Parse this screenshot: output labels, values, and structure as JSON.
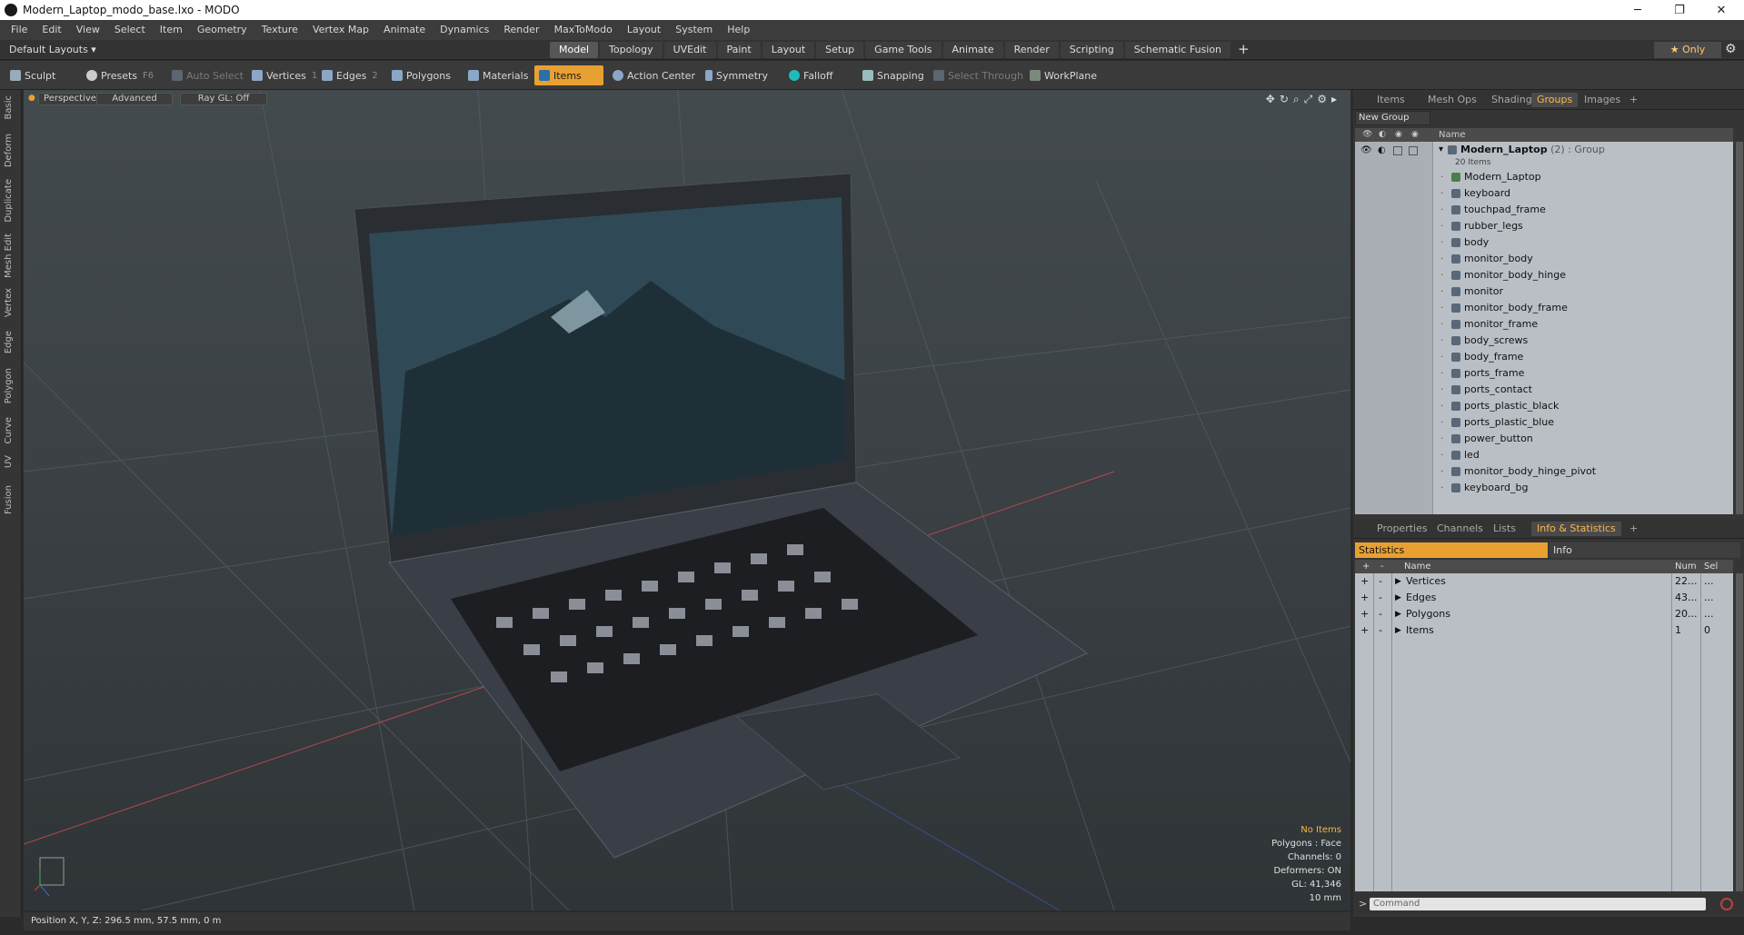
{
  "window": {
    "title": "Modern_Laptop_modo_base.lxo - MODO",
    "minimize": "─",
    "maximize": "❐",
    "close": "✕"
  },
  "menu": [
    "File",
    "Edit",
    "View",
    "Select",
    "Item",
    "Geometry",
    "Texture",
    "Vertex Map",
    "Animate",
    "Dynamics",
    "Render",
    "MaxToModo",
    "Layout",
    "System",
    "Help"
  ],
  "layouts": {
    "label": "Default Layouts ▾"
  },
  "tabs": [
    "Model",
    "Topology",
    "UVEdit",
    "Paint",
    "Layout",
    "Setup",
    "Game Tools",
    "Animate",
    "Render",
    "Scripting",
    "Schematic Fusion"
  ],
  "tabs_plus": "+",
  "only_label": "★  Only",
  "toolbar": {
    "sculpt": "Sculpt",
    "presets": "Presets",
    "presets_key": "F6",
    "auto_select": "Auto Select",
    "vertices": "Vertices",
    "vertices_key": "1",
    "edges": "Edges",
    "edges_key": "2",
    "polygons": "Polygons",
    "materials": "Materials",
    "items": "Items",
    "action_center": "Action Center",
    "symmetry": "Symmetry",
    "falloff": "Falloff",
    "snapping": "Snapping",
    "select_through": "Select Through",
    "workplane": "WorkPlane"
  },
  "left_tabs": [
    "Basic",
    "Deform",
    "Duplicate",
    "Mesh Edit",
    "Vertex",
    "Edge",
    "Polygon",
    "Curve",
    "UV",
    "Fusion"
  ],
  "viewport": {
    "perspective": "Perspective",
    "advanced": "Advanced",
    "raygl": "Ray GL: Off",
    "hud": {
      "no_items": "No Items",
      "polygons": "Polygons : Face",
      "channels": "Channels: 0",
      "deformers": "Deformers: ON",
      "gl": "GL: 41,346",
      "scale": "10 mm"
    }
  },
  "right_tabs": [
    "Items",
    "Mesh Ops",
    "Shading",
    "Groups",
    "Images"
  ],
  "new_group": "New Group",
  "groups_header": "Name",
  "group": {
    "name": "Modern_Laptop",
    "count": "(2)",
    "type": ": Group",
    "items": "20 Items"
  },
  "group_items": [
    "Modern_Laptop",
    "keyboard",
    "touchpad_frame",
    "rubber_legs",
    "body",
    "monitor_body",
    "monitor_body_hinge",
    "monitor",
    "monitor_body_frame",
    "monitor_frame",
    "body_screws",
    "body_frame",
    "ports_frame",
    "ports_contact",
    "ports_plastic_black",
    "ports_plastic_blue",
    "power_button",
    "led",
    "monitor_body_hinge_pivot",
    "keyboard_bg"
  ],
  "lower_tabs": [
    "Properties",
    "Channels",
    "Lists",
    "Info & Statistics"
  ],
  "stats_tabs": {
    "statistics": "Statistics",
    "info": "Info"
  },
  "stats_header": {
    "plus": "+",
    "minus": "-",
    "name": "Name",
    "num": "Num",
    "sel": "Sel"
  },
  "stats": [
    {
      "name": "Vertices",
      "num": "22...",
      "sel": "..."
    },
    {
      "name": "Edges",
      "num": "43...",
      "sel": "..."
    },
    {
      "name": "Polygons",
      "num": "20...",
      "sel": "..."
    },
    {
      "name": "Items",
      "num": "1",
      "sel": "0"
    }
  ],
  "command_placeholder": "Command",
  "status": "Position X, Y, Z:   296.5 mm, 57.5 mm, 0 m",
  "colors": {
    "accent": "#e9a032",
    "tab_active": "#ffb84d",
    "list_bg": "#b9bfc5"
  }
}
